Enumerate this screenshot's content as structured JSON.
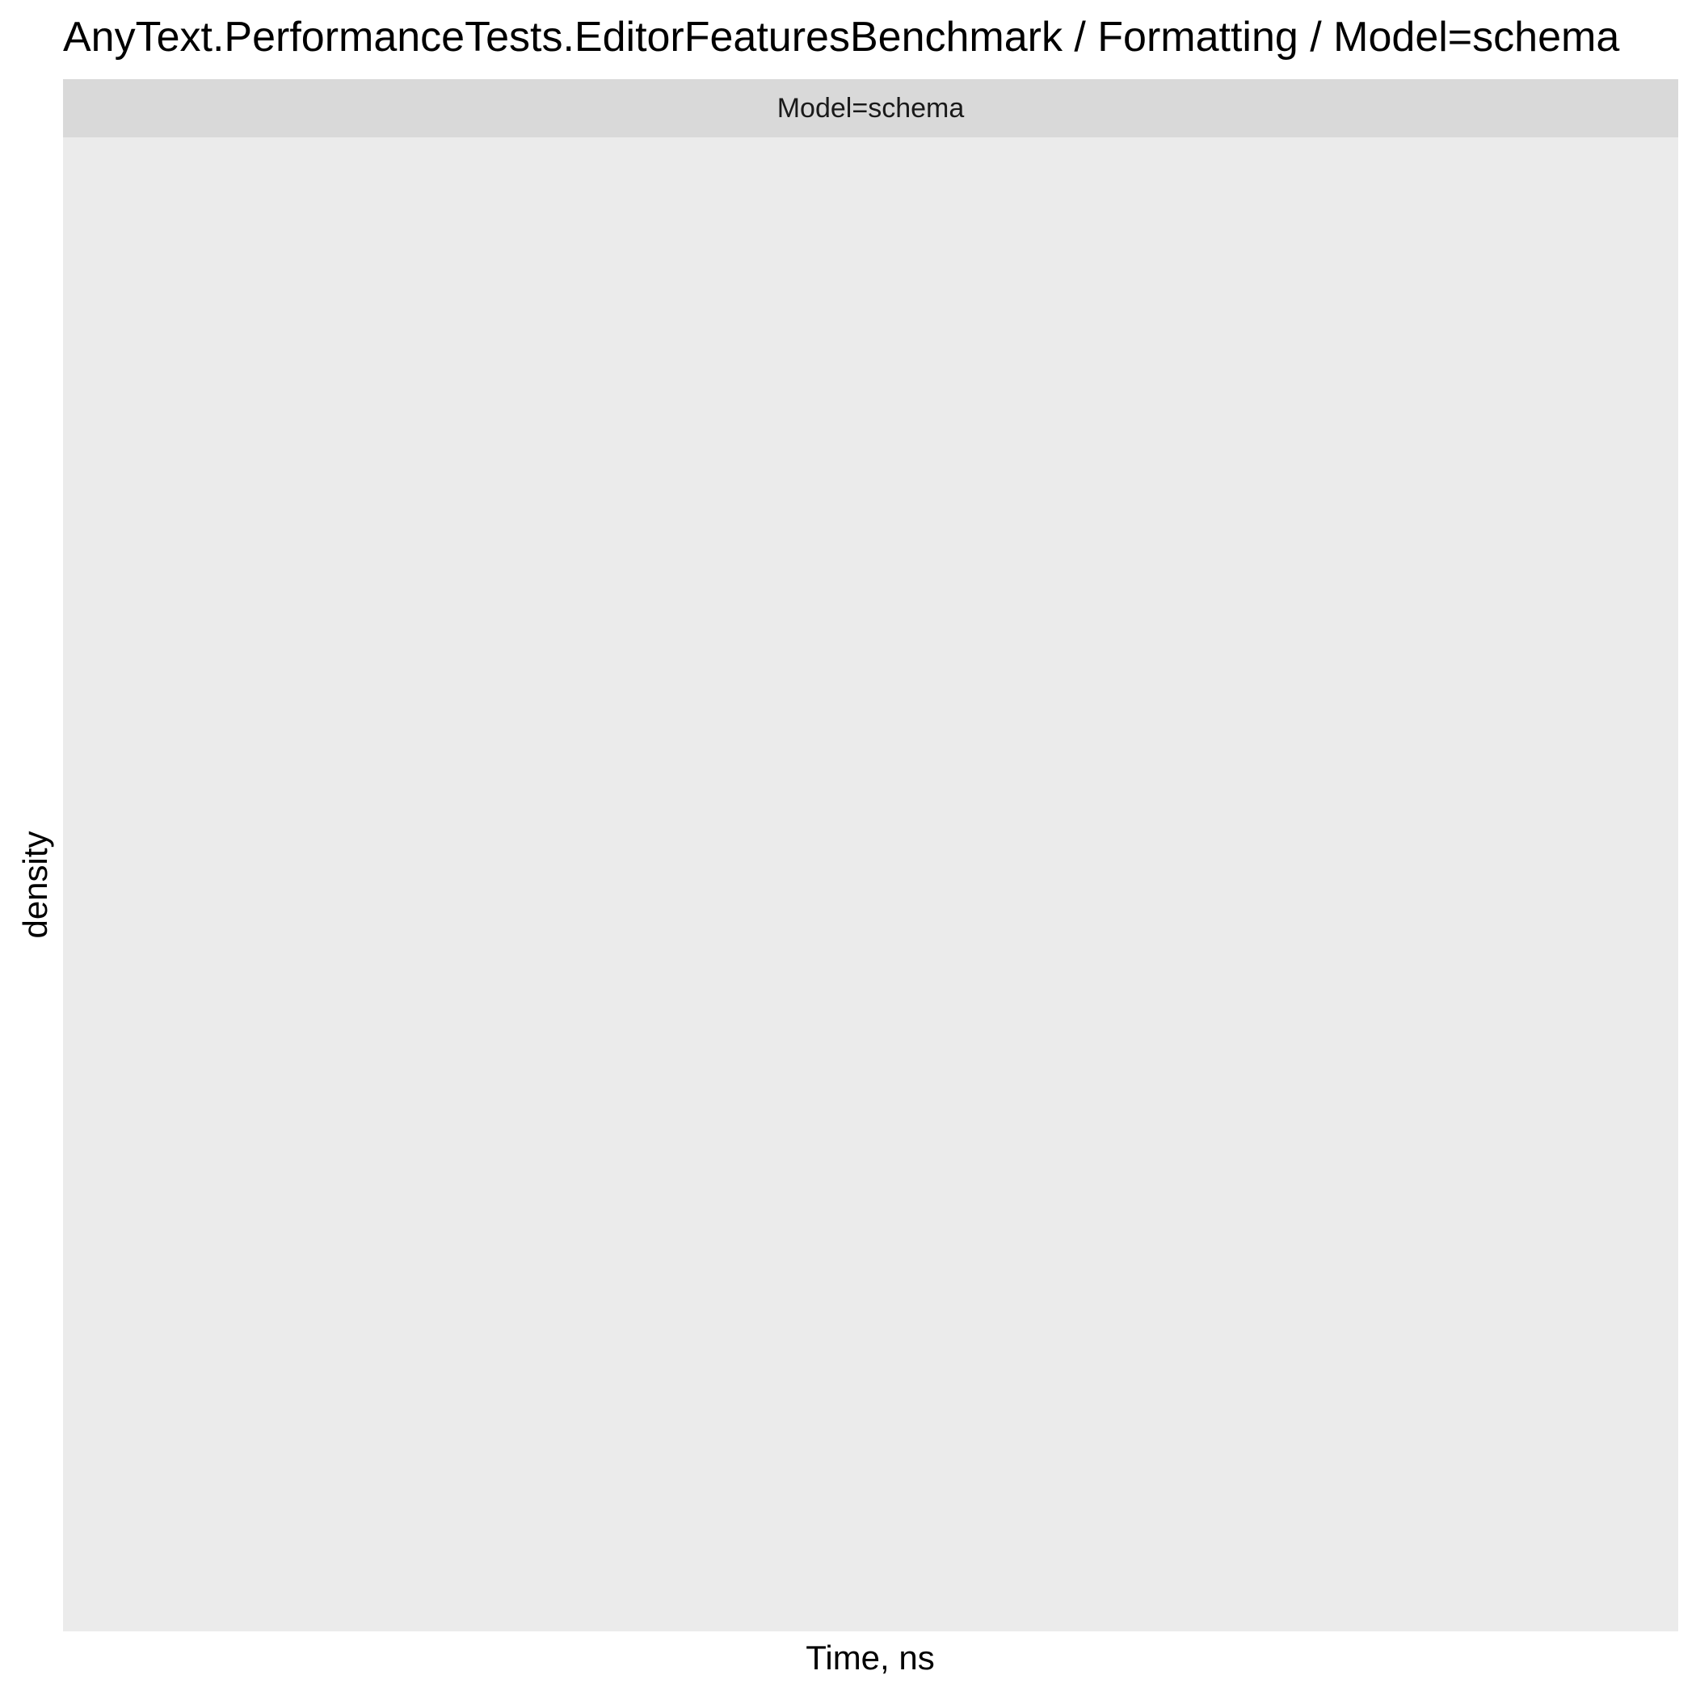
{
  "chart_data": {
    "type": "area",
    "title": "AnyText.PerformanceTests.EditorFeaturesBenchmark / Formatting / Model=schema",
    "facet": "Model=schema",
    "xlabel": "Time, ns",
    "ylabel": "density",
    "series": [],
    "grid": false,
    "panel_background": "#EBEBEB",
    "strip_background": "#D9D9D9"
  }
}
